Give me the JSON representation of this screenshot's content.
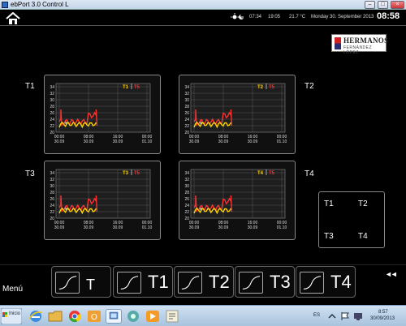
{
  "window": {
    "title": "ebPort 3.0 Control L",
    "min": "–",
    "max": "□",
    "close": "×"
  },
  "header": {
    "time1": "07:34",
    "time2": "19:05",
    "temperature": "21.7 °C",
    "date": "Monday 30. September 2013",
    "clock": "08:58"
  },
  "logo": {
    "line1": "HERMANOS",
    "line2": "FERNÁNDEZ LÓPEZ"
  },
  "channels": [
    "T1",
    "T2",
    "T3",
    "T4"
  ],
  "charts": [
    {
      "legend_main": "T1",
      "legend_alt": "T5",
      "main_color": "#ffd400",
      "alt_color": "#ff3030"
    },
    {
      "legend_main": "T2",
      "legend_alt": "T5",
      "main_color": "#ffd400",
      "alt_color": "#ff3030"
    },
    {
      "legend_main": "T3",
      "legend_alt": "T5",
      "main_color": "#ffd400",
      "alt_color": "#ff3030"
    },
    {
      "legend_main": "T4",
      "legend_alt": "T5",
      "main_color": "#ffd400",
      "alt_color": "#ff3030"
    }
  ],
  "chart_data": {
    "type": "line",
    "y_ticks": [
      "34",
      "32",
      "30",
      "28",
      "26",
      "24",
      "22",
      "20"
    ],
    "x_ticks": [
      {
        "time": "00:00",
        "date": "30.09"
      },
      {
        "time": "08:00",
        "date": "30.09"
      },
      {
        "time": "16:00",
        "date": "30.09"
      },
      {
        "time": "00:00",
        "date": "01.10"
      }
    ],
    "ylim": [
      20,
      35
    ],
    "grid": true
  },
  "selector": {
    "options": [
      "T1",
      "T2",
      "T3",
      "T4"
    ]
  },
  "tabs": [
    "T",
    "T1",
    "T2",
    "T3",
    "T4"
  ],
  "menu_label": "Menú",
  "rewind": "◄◄",
  "taskbar": {
    "start_label": "Inicio",
    "lang": "ES",
    "time": "8:57",
    "date": "30/09/2013"
  },
  "colors": {
    "background": "#000000",
    "accent": "#ffd400",
    "alt": "#ff3030"
  }
}
